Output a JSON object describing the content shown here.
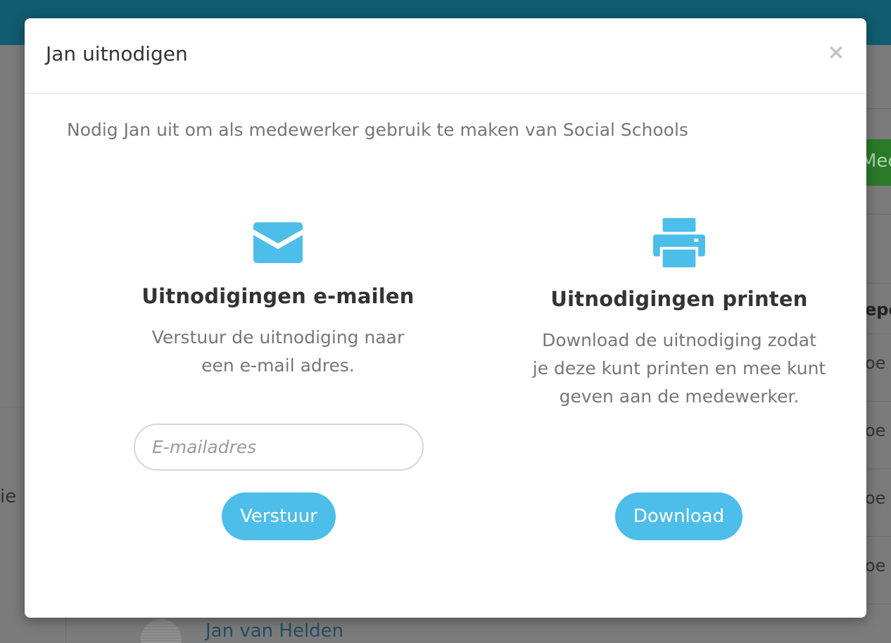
{
  "background": {
    "left_partial": "ie",
    "green_button_partial": "Mec",
    "column_header_partial": "epe",
    "row_partials": [
      "oe",
      "oe",
      "oe",
      "oe"
    ],
    "person_name": "Jan van Helden"
  },
  "modal": {
    "title": "Jan uitnodigen",
    "close_symbol": "×",
    "intro": "Nodig Jan uit om als medewerker gebruik te maken van Social Schools",
    "email_option": {
      "icon": "envelope-icon",
      "title": "Uitnodigingen e-mailen",
      "description": "Verstuur de uitnodiging naar een e-mail adres.",
      "input_placeholder": "E-mailadres",
      "input_value": "",
      "button_label": "Verstuur"
    },
    "print_option": {
      "icon": "printer-icon",
      "title": "Uitnodigingen printen",
      "description": "Download de uitnodiging zodat je deze kunt printen en mee kunt geven aan de medewerker.",
      "button_label": "Download"
    }
  },
  "colors": {
    "accent": "#4dbde9",
    "header_bar": "#115c6f",
    "title_text": "#333333",
    "body_text": "#777777"
  }
}
